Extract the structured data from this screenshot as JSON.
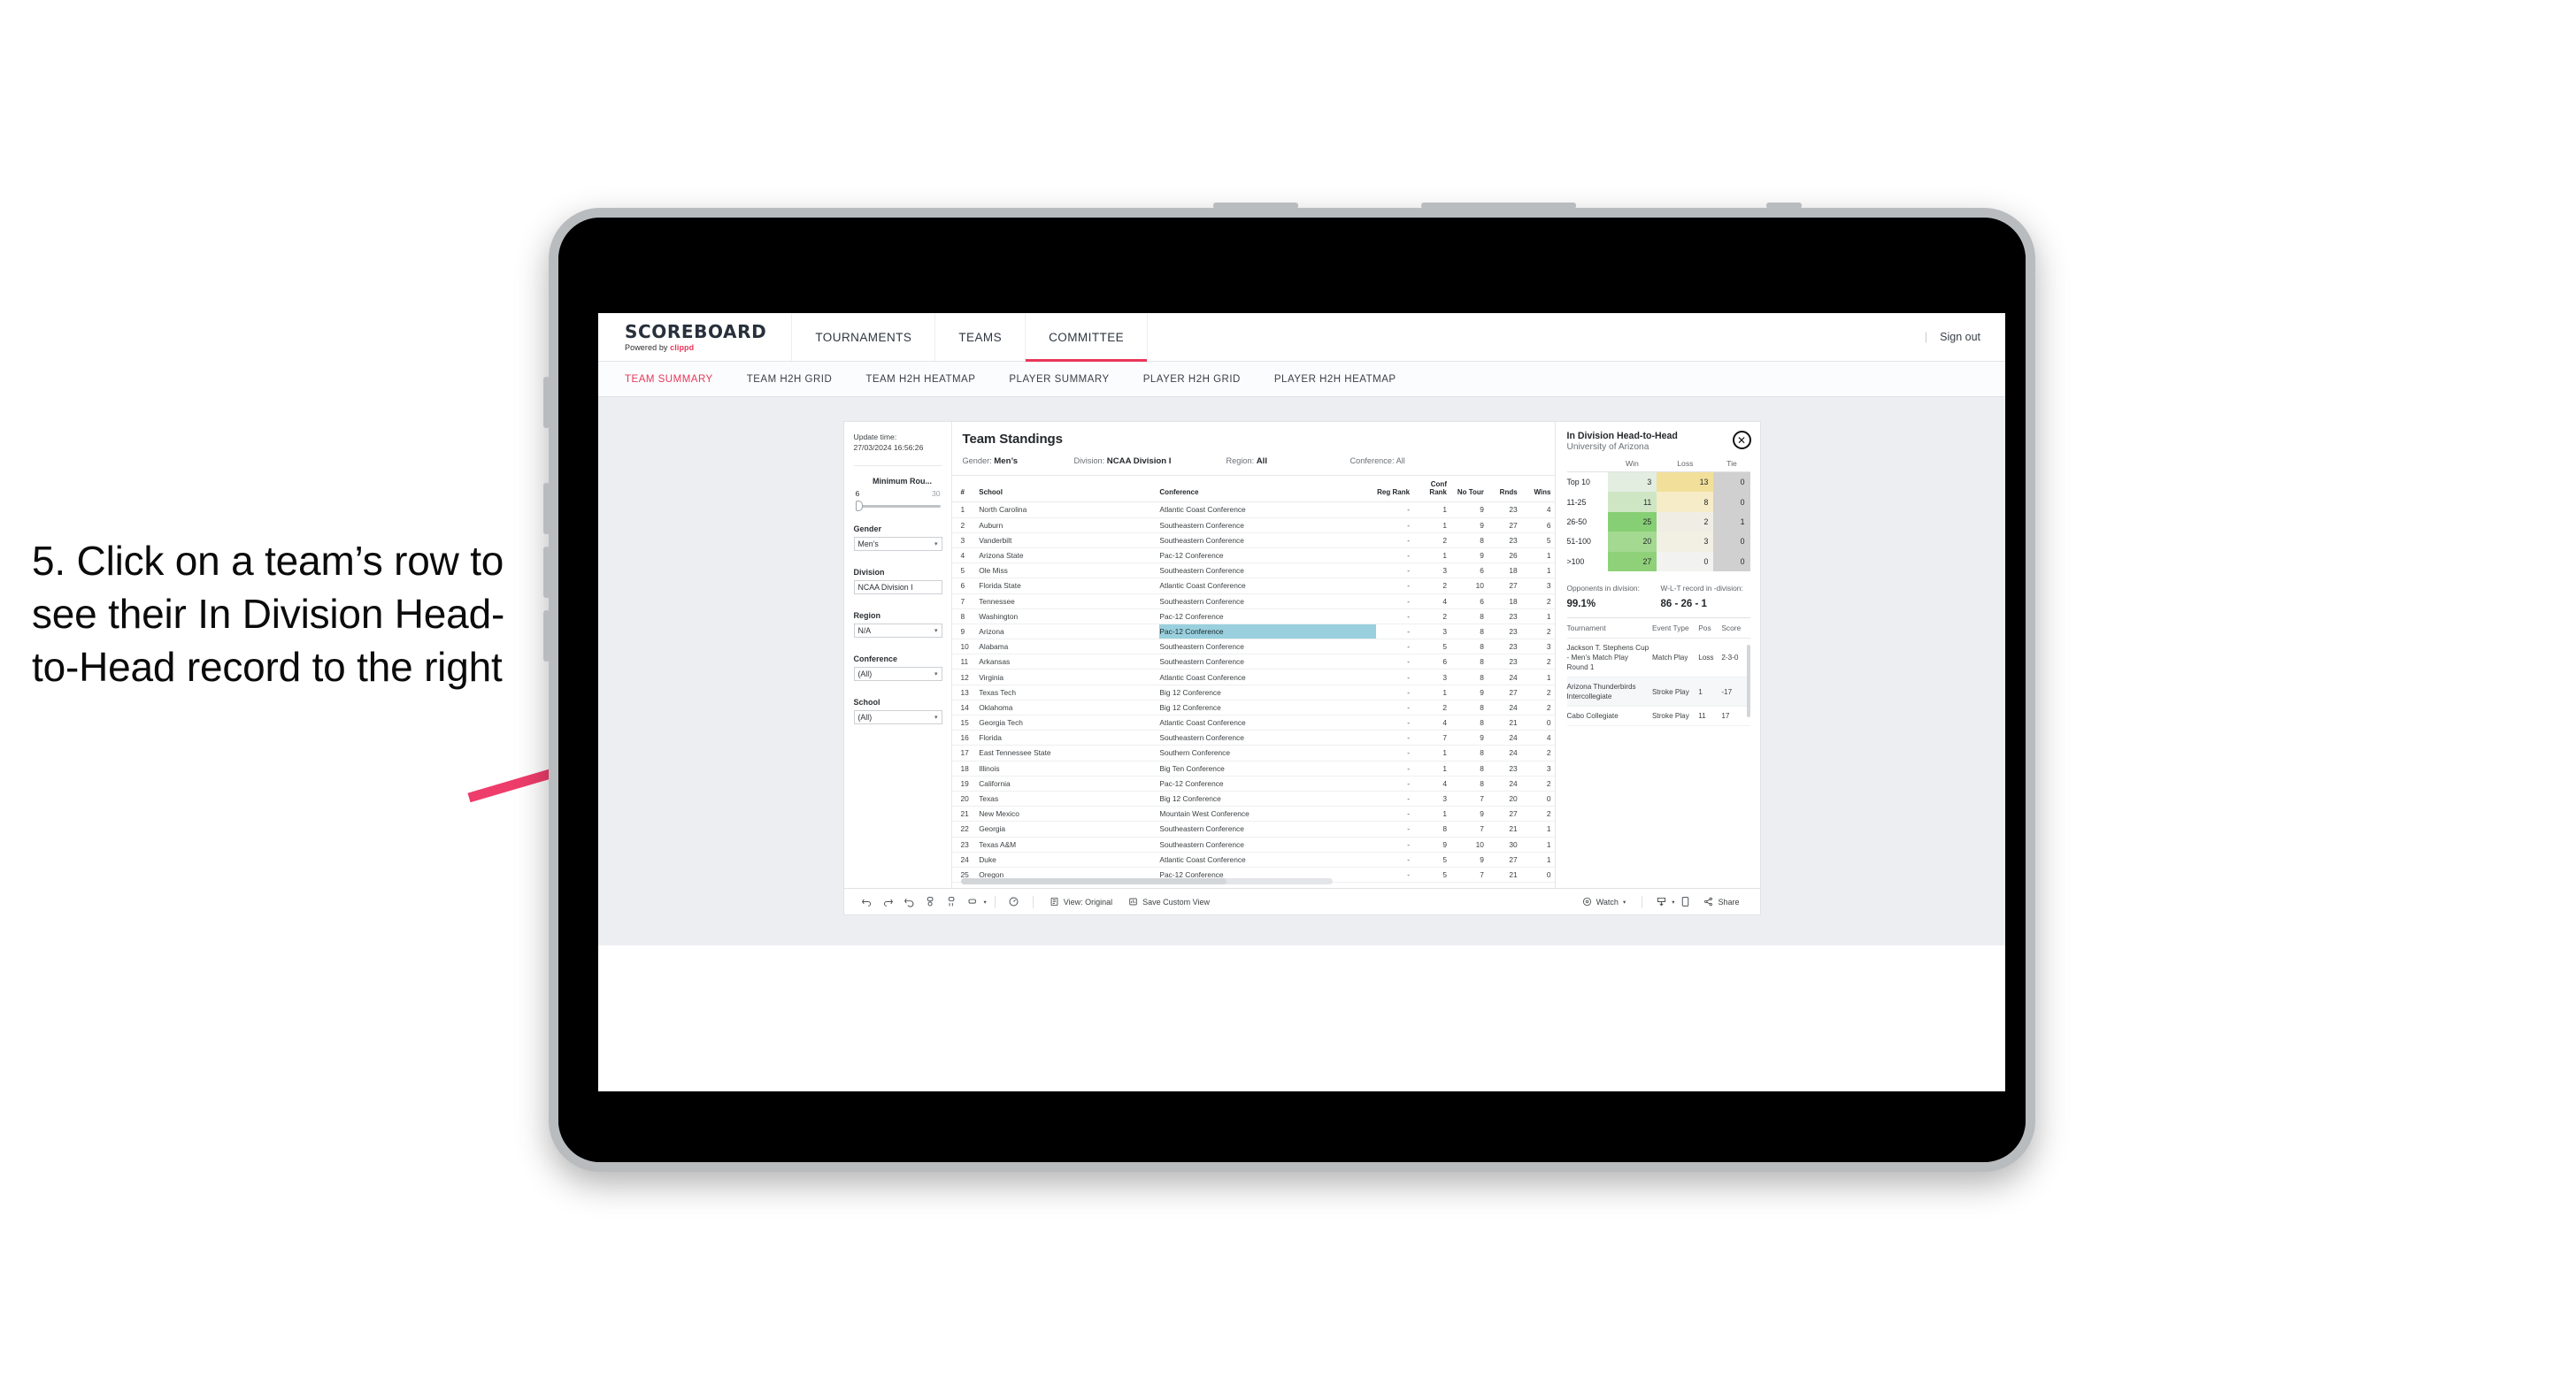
{
  "caption": "5. Click on a team’s row to see their In Division Head-to-Head record to the right",
  "brand": {
    "name": "SCOREBOARD",
    "powered_prefix": "Powered by ",
    "powered_by": "clippd"
  },
  "topnav": {
    "items": [
      {
        "label": "TOURNAMENTS",
        "active": false
      },
      {
        "label": "TEAMS",
        "active": false
      },
      {
        "label": "COMMITTEE",
        "active": true
      }
    ],
    "separator": "|",
    "sign_out": "Sign out"
  },
  "subnav": {
    "items": [
      {
        "label": "TEAM SUMMARY",
        "active": true
      },
      {
        "label": "TEAM H2H GRID",
        "active": false
      },
      {
        "label": "TEAM H2H HEATMAP",
        "active": false
      },
      {
        "label": "PLAYER SUMMARY",
        "active": false
      },
      {
        "label": "PLAYER H2H GRID",
        "active": false
      },
      {
        "label": "PLAYER H2H HEATMAP",
        "active": false
      }
    ]
  },
  "filters": {
    "update_label": "Update time:",
    "update_value": "27/03/2024 16:56:26",
    "slider": {
      "title": "Minimum Rou...",
      "min": "6",
      "max": "30"
    },
    "groups": [
      {
        "title": "Gender",
        "value": "Men’s"
      },
      {
        "title": "Division",
        "value": "NCAA Division I"
      },
      {
        "title": "Region",
        "value": "N/A"
      },
      {
        "title": "Conference",
        "value": "(All)"
      },
      {
        "title": "School",
        "value": "(All)"
      }
    ],
    "caret": "▾"
  },
  "standings": {
    "title": "Team Standings",
    "meta": [
      {
        "label": "Gender:",
        "value": "Men’s"
      },
      {
        "label": "Division:",
        "value": "NCAA Division I"
      },
      {
        "label": "Region:",
        "value": "All"
      },
      {
        "label": "Conference:",
        "value": "All"
      }
    ],
    "columns": [
      "#",
      "School",
      "Conference",
      "Reg Rank",
      "Conf Rank",
      "No Tour",
      "Rnds",
      "Wins"
    ],
    "rows": [
      {
        "rank": "1",
        "school": "North Carolina",
        "conference": "Atlantic Coast Conference",
        "reg_rank": "-",
        "conf_rank": "1",
        "no_tour": "9",
        "rnds": "23",
        "wins": "4",
        "selected": false
      },
      {
        "rank": "2",
        "school": "Auburn",
        "conference": "Southeastern Conference",
        "reg_rank": "-",
        "conf_rank": "1",
        "no_tour": "9",
        "rnds": "27",
        "wins": "6",
        "selected": false
      },
      {
        "rank": "3",
        "school": "Vanderbilt",
        "conference": "Southeastern Conference",
        "reg_rank": "-",
        "conf_rank": "2",
        "no_tour": "8",
        "rnds": "23",
        "wins": "5",
        "selected": false
      },
      {
        "rank": "4",
        "school": "Arizona State",
        "conference": "Pac-12 Conference",
        "reg_rank": "-",
        "conf_rank": "1",
        "no_tour": "9",
        "rnds": "26",
        "wins": "1",
        "selected": false
      },
      {
        "rank": "5",
        "school": "Ole Miss",
        "conference": "Southeastern Conference",
        "reg_rank": "-",
        "conf_rank": "3",
        "no_tour": "6",
        "rnds": "18",
        "wins": "1",
        "selected": false
      },
      {
        "rank": "6",
        "school": "Florida State",
        "conference": "Atlantic Coast Conference",
        "reg_rank": "-",
        "conf_rank": "2",
        "no_tour": "10",
        "rnds": "27",
        "wins": "3",
        "selected": false
      },
      {
        "rank": "7",
        "school": "Tennessee",
        "conference": "Southeastern Conference",
        "reg_rank": "-",
        "conf_rank": "4",
        "no_tour": "6",
        "rnds": "18",
        "wins": "2",
        "selected": false
      },
      {
        "rank": "8",
        "school": "Washington",
        "conference": "Pac-12 Conference",
        "reg_rank": "-",
        "conf_rank": "2",
        "no_tour": "8",
        "rnds": "23",
        "wins": "1",
        "selected": false
      },
      {
        "rank": "9",
        "school": "Arizona",
        "conference": "Pac-12 Conference",
        "reg_rank": "-",
        "conf_rank": "3",
        "no_tour": "8",
        "rnds": "23",
        "wins": "2",
        "selected": true
      },
      {
        "rank": "10",
        "school": "Alabama",
        "conference": "Southeastern Conference",
        "reg_rank": "-",
        "conf_rank": "5",
        "no_tour": "8",
        "rnds": "23",
        "wins": "3",
        "selected": false
      },
      {
        "rank": "11",
        "school": "Arkansas",
        "conference": "Southeastern Conference",
        "reg_rank": "-",
        "conf_rank": "6",
        "no_tour": "8",
        "rnds": "23",
        "wins": "2",
        "selected": false
      },
      {
        "rank": "12",
        "school": "Virginia",
        "conference": "Atlantic Coast Conference",
        "reg_rank": "-",
        "conf_rank": "3",
        "no_tour": "8",
        "rnds": "24",
        "wins": "1",
        "selected": false
      },
      {
        "rank": "13",
        "school": "Texas Tech",
        "conference": "Big 12 Conference",
        "reg_rank": "-",
        "conf_rank": "1",
        "no_tour": "9",
        "rnds": "27",
        "wins": "2",
        "selected": false
      },
      {
        "rank": "14",
        "school": "Oklahoma",
        "conference": "Big 12 Conference",
        "reg_rank": "-",
        "conf_rank": "2",
        "no_tour": "8",
        "rnds": "24",
        "wins": "2",
        "selected": false
      },
      {
        "rank": "15",
        "school": "Georgia Tech",
        "conference": "Atlantic Coast Conference",
        "reg_rank": "-",
        "conf_rank": "4",
        "no_tour": "8",
        "rnds": "21",
        "wins": "0",
        "selected": false
      },
      {
        "rank": "16",
        "school": "Florida",
        "conference": "Southeastern Conference",
        "reg_rank": "-",
        "conf_rank": "7",
        "no_tour": "9",
        "rnds": "24",
        "wins": "4",
        "selected": false
      },
      {
        "rank": "17",
        "school": "East Tennessee State",
        "conference": "Southern Conference",
        "reg_rank": "-",
        "conf_rank": "1",
        "no_tour": "8",
        "rnds": "24",
        "wins": "2",
        "selected": false
      },
      {
        "rank": "18",
        "school": "Illinois",
        "conference": "Big Ten Conference",
        "reg_rank": "-",
        "conf_rank": "1",
        "no_tour": "8",
        "rnds": "23",
        "wins": "3",
        "selected": false
      },
      {
        "rank": "19",
        "school": "California",
        "conference": "Pac-12 Conference",
        "reg_rank": "-",
        "conf_rank": "4",
        "no_tour": "8",
        "rnds": "24",
        "wins": "2",
        "selected": false
      },
      {
        "rank": "20",
        "school": "Texas",
        "conference": "Big 12 Conference",
        "reg_rank": "-",
        "conf_rank": "3",
        "no_tour": "7",
        "rnds": "20",
        "wins": "0",
        "selected": false
      },
      {
        "rank": "21",
        "school": "New Mexico",
        "conference": "Mountain West Conference",
        "reg_rank": "-",
        "conf_rank": "1",
        "no_tour": "9",
        "rnds": "27",
        "wins": "2",
        "selected": false
      },
      {
        "rank": "22",
        "school": "Georgia",
        "conference": "Southeastern Conference",
        "reg_rank": "-",
        "conf_rank": "8",
        "no_tour": "7",
        "rnds": "21",
        "wins": "1",
        "selected": false
      },
      {
        "rank": "23",
        "school": "Texas A&M",
        "conference": "Southeastern Conference",
        "reg_rank": "-",
        "conf_rank": "9",
        "no_tour": "10",
        "rnds": "30",
        "wins": "1",
        "selected": false
      },
      {
        "rank": "24",
        "school": "Duke",
        "conference": "Atlantic Coast Conference",
        "reg_rank": "-",
        "conf_rank": "5",
        "no_tour": "9",
        "rnds": "27",
        "wins": "1",
        "selected": false
      },
      {
        "rank": "25",
        "school": "Oregon",
        "conference": "Pac-12 Conference",
        "reg_rank": "-",
        "conf_rank": "5",
        "no_tour": "7",
        "rnds": "21",
        "wins": "0",
        "selected": false
      }
    ]
  },
  "h2h": {
    "title": "In Division Head-to-Head",
    "subtitle": "University of Arizona",
    "close_icon": "✕",
    "heatmap": {
      "columns": [
        "Win",
        "Loss",
        "Tie"
      ],
      "rows": [
        {
          "label": "Top 10",
          "win": "3",
          "loss": "13",
          "tie": "0",
          "win_color": "#e3eee1",
          "loss_color": "#f2e09a",
          "tie_color": "#d0d0d0"
        },
        {
          "label": "11-25",
          "win": "11",
          "loss": "8",
          "tie": "0",
          "win_color": "#cfe6c4",
          "loss_color": "#f6ecc8",
          "tie_color": "#d0d0d0"
        },
        {
          "label": "26-50",
          "win": "25",
          "loss": "2",
          "tie": "1",
          "win_color": "#87cf74",
          "loss_color": "#f0eee4",
          "tie_color": "#d0d0d0"
        },
        {
          "label": "51-100",
          "win": "20",
          "loss": "3",
          "tie": "0",
          "win_color": "#a3d991",
          "loss_color": "#f2efe3",
          "tie_color": "#d0d0d0"
        },
        {
          "label": ">100",
          "win": "27",
          "loss": "0",
          "tie": "0",
          "win_color": "#8ed179",
          "loss_color": "#f2f2f0",
          "tie_color": "#d0d0d0"
        }
      ]
    },
    "stats": [
      {
        "label": "Opponents in division:",
        "value": "99.1%"
      },
      {
        "label": "W-L-T record in -division:",
        "value": "86 - 26 - 1"
      }
    ],
    "tournaments": {
      "columns": [
        "Tournament",
        "Event Type",
        "Pos",
        "Score"
      ],
      "rows": [
        {
          "name": "Jackson T. Stephens Cup - Men’s Match Play Round 1",
          "event_type": "Match Play",
          "pos": "Loss",
          "score": "2-3-0"
        },
        {
          "name": "Arizona Thunderbirds Intercollegiate",
          "event_type": "Stroke Play",
          "pos": "1",
          "score": "-17"
        },
        {
          "name": "Cabo Collegiate",
          "event_type": "Stroke Play",
          "pos": "11",
          "score": "17"
        }
      ]
    }
  },
  "toolbar": {
    "view_label": "View: Original",
    "save_label": "Save Custom View",
    "watch_label": "Watch",
    "share_label": "Share",
    "caret": "▾"
  },
  "colors": {
    "accent": "#e8375a",
    "selected_row": "#9ad0de",
    "arrow": "#ee3d6b"
  }
}
